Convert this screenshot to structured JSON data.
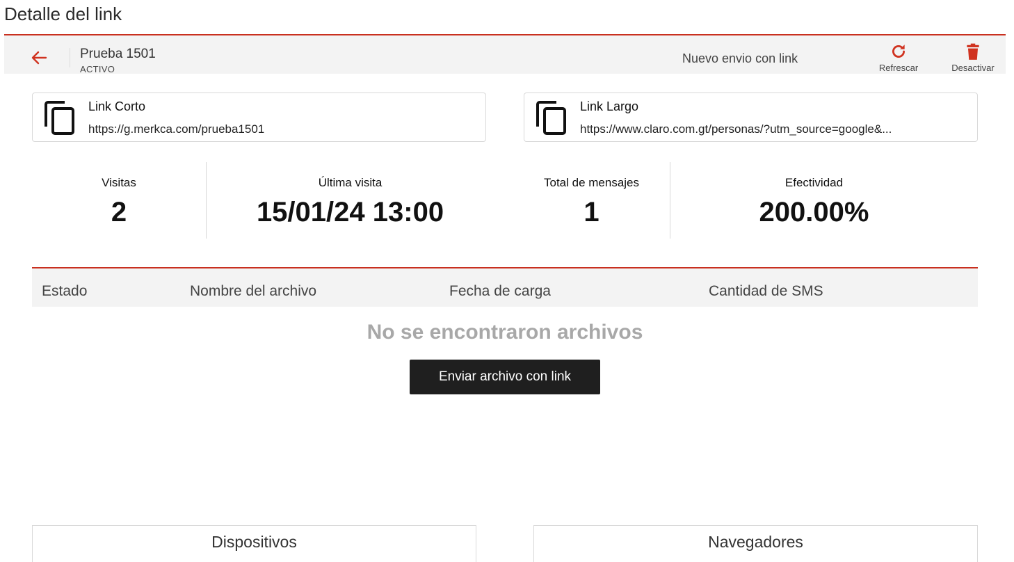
{
  "page": {
    "title": "Detalle del link"
  },
  "toolbar": {
    "link_name": "Prueba 1501",
    "link_status": "ACTIVO",
    "new_send_label": "Nuevo envio con link",
    "refresh_label": "Refrescar",
    "deactivate_label": "Desactivar",
    "accent_color": "#c9301f"
  },
  "links": {
    "short": {
      "title": "Link Corto",
      "url": "https://g.merkca.com/prueba1501"
    },
    "long": {
      "title": "Link Largo",
      "url": "https://www.claro.com.gt/personas/?utm_source=google&..."
    }
  },
  "stats": [
    {
      "label": "Visitas",
      "value": "2"
    },
    {
      "label": "Última visita",
      "value": "15/01/24 13:00"
    },
    {
      "label": "Total de mensajes",
      "value": "1"
    },
    {
      "label": "Efectividad",
      "value": "200.00%"
    }
  ],
  "files_table": {
    "columns": [
      "Estado",
      "Nombre del archivo",
      "Fecha de carga",
      "Cantidad de SMS"
    ],
    "empty_message": "No se encontraron archivos",
    "send_button_label": "Enviar archivo con link"
  },
  "panels": {
    "devices_title": "Dispositivos",
    "browsers_title": "Navegadores"
  },
  "icons": {
    "back": "arrow-left-icon",
    "refresh": "refresh-icon",
    "deactivate": "trash-icon",
    "copy": "copy-icon"
  }
}
